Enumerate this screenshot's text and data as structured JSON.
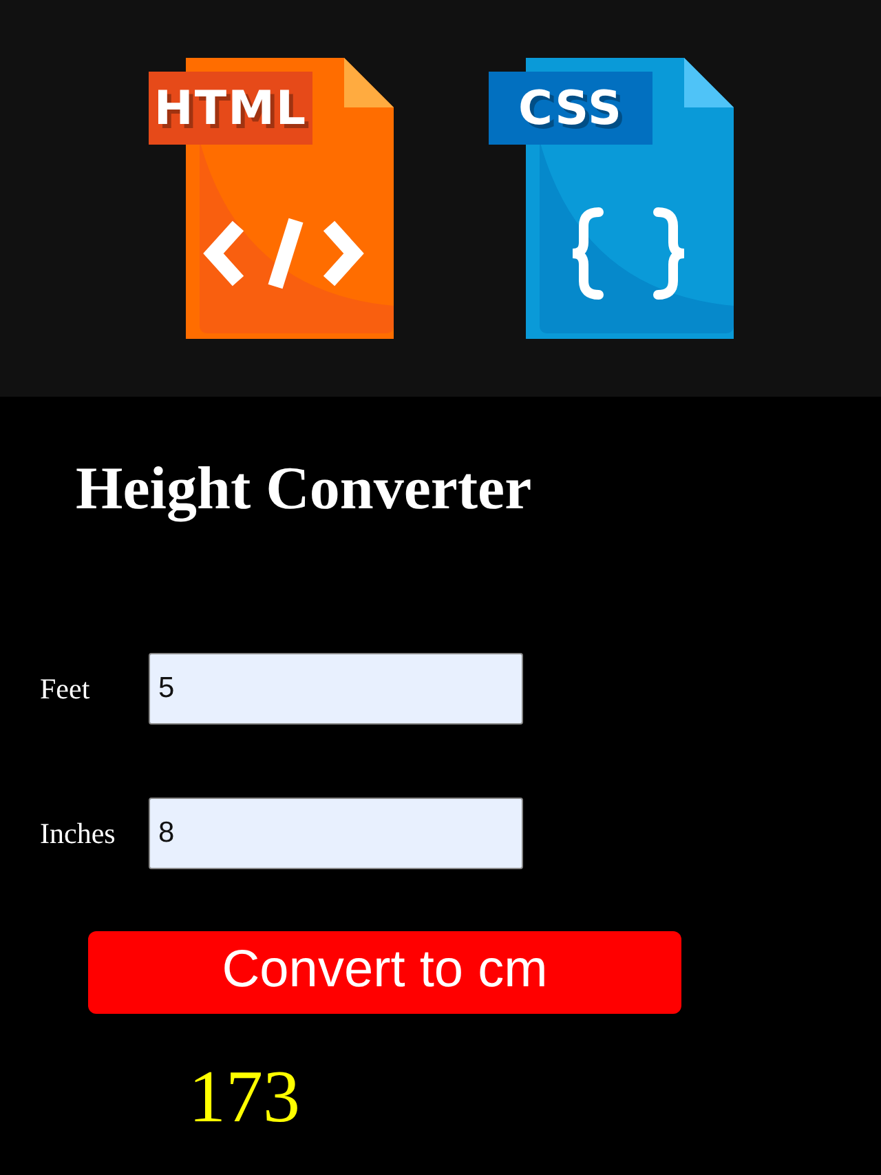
{
  "banner": {
    "icons": [
      {
        "kind": "html",
        "label": "HTML"
      },
      {
        "kind": "css",
        "label": "CSS"
      }
    ]
  },
  "title": "Height Converter",
  "fields": [
    {
      "label": "Feet",
      "value": "5"
    },
    {
      "label": "Inches",
      "value": "8"
    }
  ],
  "button": "Convert to cm",
  "result": "173"
}
